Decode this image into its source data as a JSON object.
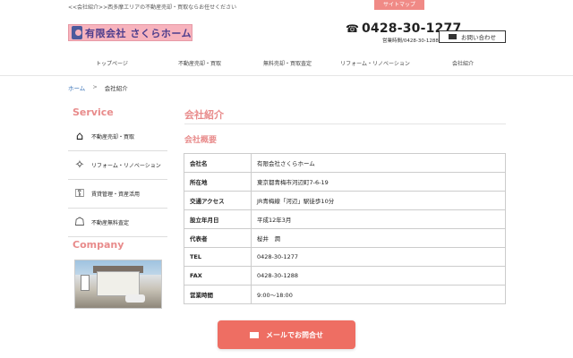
{
  "header": {
    "tagline": "<<会社紹介>>西多摩エリアの不動産売却・買取ならお任せください",
    "sitemap_label": "サイトマップ",
    "logo_text": "有限会社 さくらホーム",
    "phone": "0428-30-1277",
    "hours": "営業時間/0428-30-1288",
    "contact_label": "お問い合わせ"
  },
  "nav": {
    "items": [
      "トップページ",
      "不動産売却・買取",
      "無料売却・買取査定",
      "リフォーム・リノベーション",
      "会社紹介"
    ]
  },
  "breadcrumb": {
    "home": "ホーム",
    "sep": ">",
    "current": "会社紹介"
  },
  "sidebar": {
    "service_title": "Service",
    "items": [
      {
        "label": "不動産売却・買取",
        "icon": "house-icon"
      },
      {
        "label": "リフォーム・リノベーション",
        "icon": "sparkle-house-icon"
      },
      {
        "label": "賃貸管理・資産活用",
        "icon": "key-icon"
      },
      {
        "label": "不動産無料査定",
        "icon": "appraisal-icon"
      }
    ],
    "company_title": "Company"
  },
  "main": {
    "title": "会社紹介",
    "subtitle": "会社概要",
    "rows": [
      {
        "k": "会社名",
        "v": "有限会社さくらホーム"
      },
      {
        "k": "所在地",
        "v": "東京都青梅市河辺町7-6-19"
      },
      {
        "k": "交通アクセス",
        "v": "JR青梅線「河辺」駅徒歩10分"
      },
      {
        "k": "設立年月日",
        "v": "平成12年3月"
      },
      {
        "k": "代表者",
        "v": "桜井　潤"
      },
      {
        "k": "TEL",
        "v": "0428-30-1277"
      },
      {
        "k": "FAX",
        "v": "0428-30-1288"
      },
      {
        "k": "営業時間",
        "v": "9:00〜18:00"
      }
    ]
  },
  "footer_cta": {
    "label": "メールでお問合せ"
  },
  "colors": {
    "accent": "#e88b8b",
    "cta": "#ee6e63",
    "link": "#3a73b8"
  }
}
